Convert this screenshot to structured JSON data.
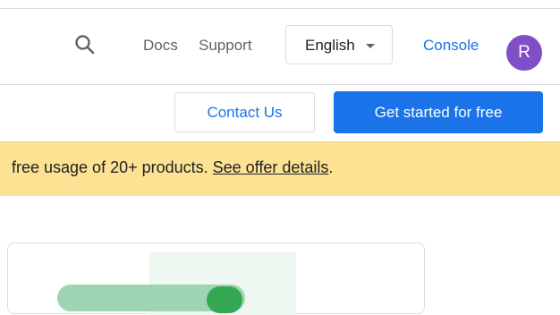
{
  "header": {
    "nav_links": [
      "Docs",
      "Support"
    ],
    "language": {
      "selected": "English"
    },
    "console_label": "Console",
    "avatar_initial": "R"
  },
  "actions": {
    "contact_label": "Contact Us",
    "get_started_label": "Get started for free"
  },
  "banner": {
    "text": "free usage of 20+ products. ",
    "link_label": "See offer details",
    "trailing": "."
  },
  "icons": {
    "search": "search-icon",
    "language_caret": "caret-down-icon"
  },
  "colors": {
    "accent": "#1a73e8",
    "banner_bg": "#fde293",
    "avatar_bg": "#7e4fc7",
    "card_green": "#34a853"
  }
}
